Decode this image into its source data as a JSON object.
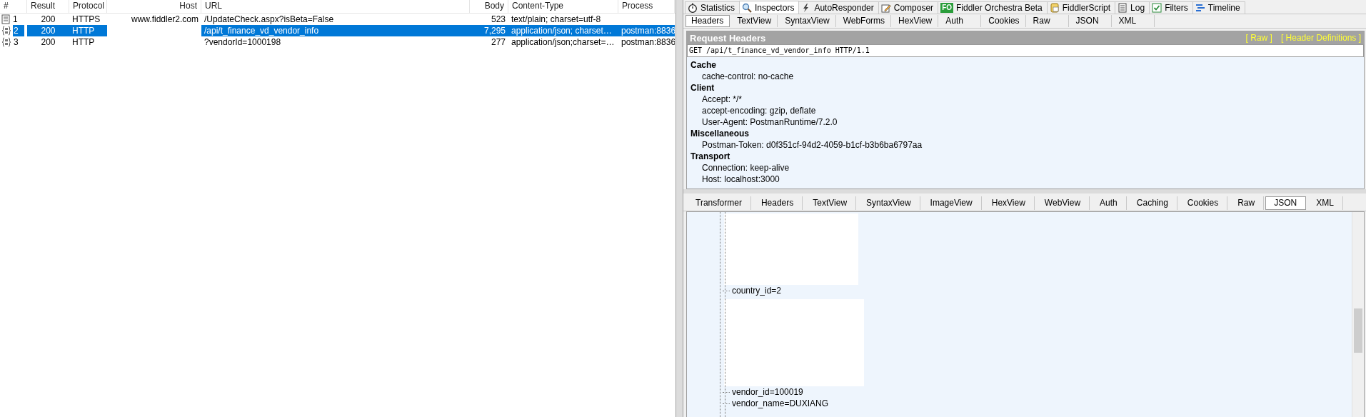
{
  "sessions": {
    "columns": [
      "#",
      "Result",
      "Protocol",
      "Host",
      "URL",
      "Body",
      "Content-Type",
      "Process"
    ],
    "rows": [
      {
        "kind": "document",
        "num": "1",
        "result": "200",
        "protocol": "HTTPS",
        "host": "www.fiddler2.com",
        "url": "/UpdateCheck.aspx?isBeta=False",
        "body": "523",
        "content_type": "text/plain; charset=utf-8",
        "selected": false
      },
      {
        "kind": "json",
        "num": "2",
        "result": "200",
        "protocol": "HTTP",
        "url": "/api/t_finance_vd_vendor_info",
        "body": "7,295",
        "content_type": "application/json; charset…",
        "process": "postman:8836",
        "selected": true
      },
      {
        "kind": "json",
        "num": "3",
        "result": "200",
        "protocol": "HTTP",
        "url": "?vendorId=1000198",
        "body": "277",
        "content_type": "application/json;charset=…",
        "process": "postman:8836",
        "selected": false
      }
    ]
  },
  "inspector": {
    "tabs": [
      {
        "label": "Statistics",
        "selected": false
      },
      {
        "label": "Inspectors",
        "selected": true
      },
      {
        "label": "AutoResponder",
        "selected": false
      },
      {
        "label": "Composer",
        "selected": false
      },
      {
        "badge": "FO",
        "label": "Fiddler Orchestra Beta",
        "selected": false
      },
      {
        "label": "FiddlerScript",
        "selected": false
      },
      {
        "label": "Log",
        "selected": false
      },
      {
        "label": "Filters",
        "selected": false
      },
      {
        "label": "Timeline",
        "selected": false
      }
    ],
    "request_tabs": [
      {
        "label": "Headers",
        "selected": true
      },
      {
        "label": "TextView",
        "selected": false
      },
      {
        "label": "SyntaxView",
        "selected": false
      },
      {
        "label": "WebForms",
        "selected": false
      },
      {
        "label": "HexView",
        "selected": false
      },
      {
        "label": "Auth",
        "selected": false
      },
      {
        "label": "Cookies",
        "selected": false
      },
      {
        "label": "Raw",
        "selected": false
      },
      {
        "label": "JSON",
        "selected": false
      },
      {
        "label": "XML",
        "selected": false
      }
    ],
    "request_headers": {
      "title": "Request Headers",
      "links": [
        "[ Raw ]",
        "[ Header Definitions ]"
      ],
      "request_line": "GET /api/t_finance_vd_vendor_info HTTP/1.1",
      "groups": [
        {
          "name": "Cache",
          "headers": [
            "cache-control: no-cache"
          ]
        },
        {
          "name": "Client",
          "headers": [
            "Accept: */*",
            "accept-encoding: gzip, deflate",
            "User-Agent: PostmanRuntime/7.2.0"
          ]
        },
        {
          "name": "Miscellaneous",
          "headers": [
            "Postman-Token: d0f351cf-94d2-4059-b1cf-b3b6ba6797aa"
          ]
        },
        {
          "name": "Transport",
          "headers": [
            "Connection: keep-alive",
            "Host: localhost:3000"
          ]
        }
      ]
    },
    "response_tabs": [
      {
        "label": "Transformer",
        "selected": false
      },
      {
        "label": "Headers",
        "selected": false
      },
      {
        "label": "TextView",
        "selected": false
      },
      {
        "label": "SyntaxView",
        "selected": false
      },
      {
        "label": "ImageView",
        "selected": false
      },
      {
        "label": "HexView",
        "selected": false
      },
      {
        "label": "WebView",
        "selected": false
      },
      {
        "label": "Auth",
        "selected": false
      },
      {
        "label": "Caching",
        "selected": false
      },
      {
        "label": "Cookies",
        "selected": false
      },
      {
        "label": "Raw",
        "selected": false
      },
      {
        "label": "JSON",
        "selected": true
      },
      {
        "label": "XML",
        "selected": false
      }
    ],
    "json_tree": [
      {
        "kind": "blank"
      },
      {
        "kind": "node",
        "text": "country_id=2"
      },
      {
        "kind": "blank"
      },
      {
        "kind": "node",
        "text": "vendor_id=100019"
      },
      {
        "kind": "node",
        "text": "vendor_name=DUXIANG"
      }
    ]
  }
}
